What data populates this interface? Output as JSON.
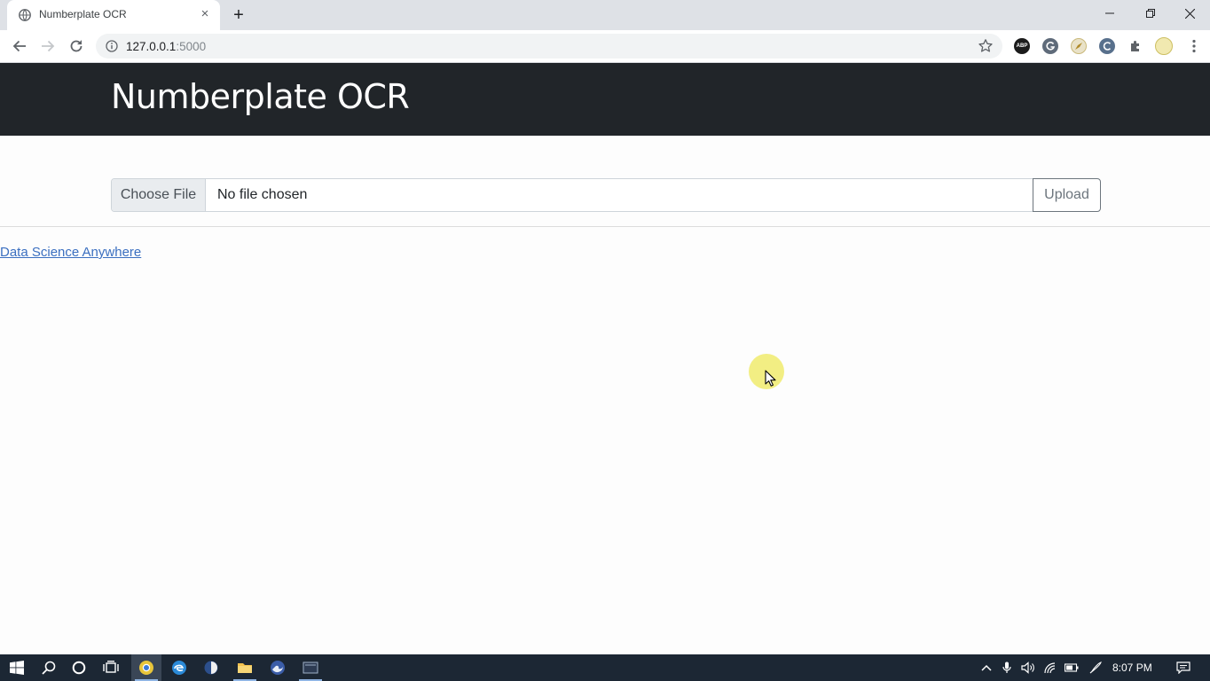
{
  "browser": {
    "tab": {
      "title": "Numberplate OCR",
      "close_icon": "×"
    },
    "new_tab_label": "+",
    "address": {
      "host": "127.0.0.1",
      "port": ":5000"
    },
    "extensions": [
      "abp-icon",
      "grammarly-icon",
      "compass-extension-icon",
      "colorzilla-icon",
      "puzzle-icon",
      "profile-avatar-icon"
    ]
  },
  "page": {
    "header_title": "Numberplate OCR",
    "file_input": {
      "button_label": "Choose File",
      "status": "No file chosen"
    },
    "upload_button": "Upload",
    "footer_link": "Data Science Anywhere"
  },
  "taskbar": {
    "time": "8:07 PM",
    "pinned": [
      "start-icon",
      "search-icon",
      "cortana-icon",
      "task-view-icon",
      "chrome-icon",
      "edge-icon",
      "app-icon",
      "file-explorer-icon",
      "firefox-icon",
      "app-window-icon"
    ]
  },
  "colors": {
    "header_bg": "#212529",
    "link": "#3b6fc0",
    "upload_border": "#6c757d",
    "taskbar_bg": "#1c2734"
  }
}
